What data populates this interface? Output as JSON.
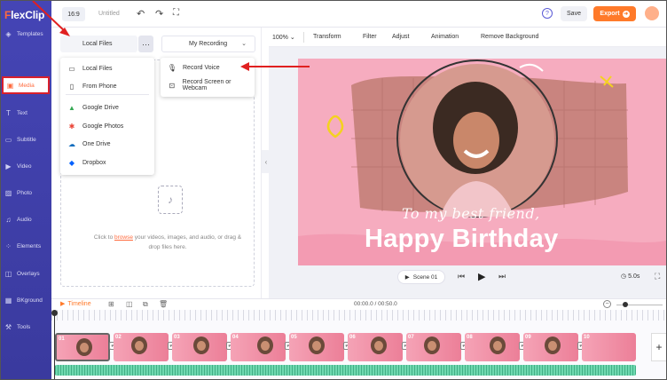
{
  "app": {
    "logo_prefix": "F",
    "logo_rest": "lexClip"
  },
  "sidebar": {
    "items": [
      {
        "label": "Templates",
        "icon": "layers-icon"
      },
      {
        "label": "Media",
        "icon": "folder-icon"
      },
      {
        "label": "Text",
        "icon": "text-icon"
      },
      {
        "label": "Subtitle",
        "icon": "subtitle-icon"
      },
      {
        "label": "Video",
        "icon": "video-icon"
      },
      {
        "label": "Photo",
        "icon": "photo-icon"
      },
      {
        "label": "Audio",
        "icon": "music-icon"
      },
      {
        "label": "Elements",
        "icon": "elements-icon"
      },
      {
        "label": "Overlays",
        "icon": "overlays-icon"
      },
      {
        "label": "BKground",
        "icon": "background-icon"
      },
      {
        "label": "Tools",
        "icon": "tools-icon"
      }
    ],
    "active": "Media"
  },
  "header": {
    "ratio": "16:9",
    "title": "Untitled",
    "save": "Save",
    "export": "Export",
    "help": "?"
  },
  "media": {
    "tab_local": "Local Files",
    "tab_more": "···",
    "tab_recording": "My Recording",
    "drop_before": "Click to ",
    "drop_link": "browse",
    "drop_after": " your videos, images, and audio, or drag & drop files here."
  },
  "local_menu": {
    "items": [
      "Local Files",
      "From Phone",
      "Google Drive",
      "Google Photos",
      "One Drive",
      "Dropbox"
    ]
  },
  "rec_menu": {
    "items": [
      "Record Voice",
      "Record Screen or Webcam"
    ]
  },
  "toolbar": {
    "zoom": "100%",
    "items": [
      "Transform",
      "Filter",
      "Adjust",
      "Animation",
      "Remove Background"
    ]
  },
  "canvas": {
    "line1": "To my best friend,",
    "line2": "Happy Birthday"
  },
  "playback": {
    "scene": "Scene 01",
    "duration": "5.0s"
  },
  "timeline": {
    "label": "Timeline",
    "time": "00:00.0 / 00:50.0",
    "clips": [
      "01",
      "02",
      "03",
      "04",
      "05",
      "06",
      "07",
      "08",
      "09",
      "10"
    ]
  },
  "colors": {
    "accent": "#ff7a2a",
    "sidebar": "#3f3fa8",
    "highlight": "#d9202c"
  }
}
